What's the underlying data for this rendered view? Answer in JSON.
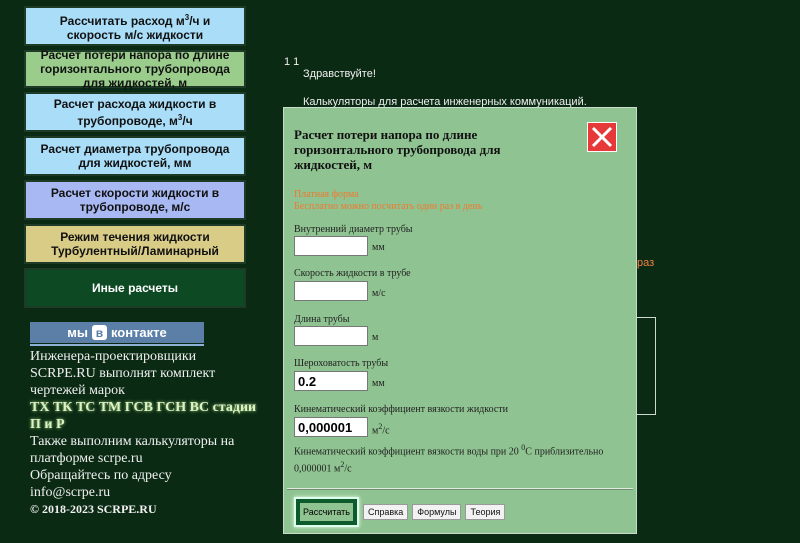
{
  "sidebar": {
    "items": [
      {
        "label_pre": "Рассчитать расход м",
        "label_sup": "3",
        "label_post": "/ч и скорость м/с жидкости"
      },
      {
        "label": "Расчет потери напора по длине горизонтального трубопровода для жидкостей, м"
      },
      {
        "label_pre": "Расчет расхода жидкости в трубопроводе, м",
        "label_sup": "3",
        "label_post": "/ч"
      },
      {
        "label": "Расчет диаметра трубопровода для жидкостей, мм"
      },
      {
        "label": "Расчет скорости жидкости в трубопроводе, м/с"
      },
      {
        "label": "Режим течения жидкости Турбулентный/Ламинарный"
      },
      {
        "label": "Иные расчеты"
      }
    ]
  },
  "vk": {
    "pre": "мы",
    "b": "в",
    "post": "контакте"
  },
  "info": {
    "line1": "Инженера-проектировщики SCRPE.RU выполнят комплект чертежей марок",
    "marks": "ТХ ТК ТС ТМ ГСВ ГСН ВС стадии П и Р",
    "line2": "Также выполним калькуляторы на платформе scrpe.ru",
    "line3": "Обращайтесь по адресу",
    "email": "info@scrpe.ru",
    "copyright": "© 2018-2023 SCRPE.RU"
  },
  "background": {
    "top_num": "1 1",
    "hello": "Здравствуйте!",
    "calcs": "Калькуляторы для расчета инженерных коммуникаций.",
    "raz": "раз"
  },
  "modal": {
    "title": "Расчет потери напора по длине горизонтального трубопровода для жидкостей, м",
    "paid1": "Платная форма",
    "paid2": "Бесплатно можно посчитать один раз в день",
    "fields": [
      {
        "label": "Внутренний диаметр трубы",
        "value": "",
        "unit": "мм"
      },
      {
        "label": "Скорость жидкости в трубе",
        "value": "",
        "unit": "м/с"
      },
      {
        "label": "Длина трубы",
        "value": "",
        "unit": "м"
      },
      {
        "label": "Шероховатость трубы",
        "value": "0.2",
        "unit": "мм"
      },
      {
        "label": "Кинематический коэффициент вязкости жидкости",
        "value": "0,000001",
        "unit_pre": "м",
        "unit_sup": "2",
        "unit_post": "/с"
      }
    ],
    "note_pre": "Кинематический коэффициент вязкости воды при 20 ",
    "note_sup": "0",
    "note_mid": "С приблизительно 0,000001 м",
    "note_sup2": "2",
    "note_post": "/с",
    "buttons": {
      "calculate": "Рассчитать",
      "help": "Справка",
      "formulas": "Формулы",
      "theory": "Теория"
    }
  },
  "colors": {
    "page_bg": "#0b2a14",
    "modal_bg": "#8fc391",
    "close": "#e63a3a",
    "accent_orange": "#f07a30"
  }
}
